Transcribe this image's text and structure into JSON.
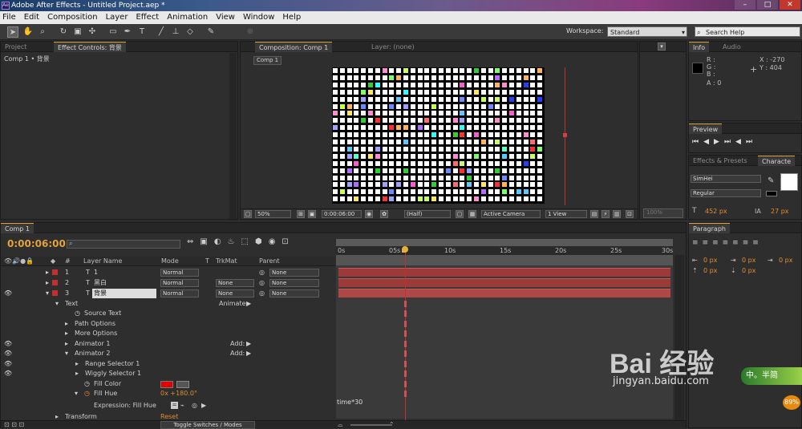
{
  "window": {
    "title": "Adobe After Effects - Untitled Project.aep *",
    "app_icon": "Ae"
  },
  "menu": [
    "File",
    "Edit",
    "Composition",
    "Layer",
    "Effect",
    "Animation",
    "View",
    "Window",
    "Help"
  ],
  "toolbar": {
    "workspace_label": "Workspace:",
    "workspace_value": "Standard",
    "search_placeholder": "Search Help"
  },
  "project_panel": {
    "tabs": [
      "Project",
      "Effect Controls: 背景"
    ],
    "breadcrumb": "Comp 1 • 背景"
  },
  "comp_panel": {
    "tabs": [
      "Composition: Comp 1",
      "Layer: (none)"
    ],
    "comp_tab": "Comp 1",
    "footer": {
      "zoom": "50%",
      "timecode": "0:00:06:00",
      "resolution": "(Half)",
      "camera": "Active Camera",
      "view": "1 View",
      "zoom_right": "100%"
    },
    "grid_colors": [
      "#ff5bd0",
      "#5bc8ff",
      "#ffe85b",
      "#7bff6b",
      "#ff6b6b",
      "#b56bff",
      "#5bffc9",
      "#ffb35b",
      "#6b8bff",
      "#ff8bd0",
      "#c9ff5b",
      "#a0a0ff",
      "#ff3030",
      "#30ffff",
      "#2040ff",
      "#30d030"
    ]
  },
  "info_panel": {
    "tabs": [
      "Info",
      "Audio"
    ],
    "R": "R :",
    "G": "G :",
    "B": "B :",
    "A": "A : 0",
    "X": "X : -270",
    "Y": "Y : 404"
  },
  "preview_panel": {
    "tab": "Preview"
  },
  "effects_panel": {
    "tabs": [
      "Effects & Presets",
      "Characte"
    ],
    "font": "SimHei",
    "style": "Regular",
    "size": "452 px",
    "tracking": "27 px"
  },
  "paragraph_panel": {
    "tab": "Paragraph",
    "values": [
      "0 px",
      "0 px",
      "0 px",
      "0 px",
      "0 px"
    ]
  },
  "timeline": {
    "tab": "Comp 1",
    "timecode": "0:00:06:00",
    "columns": {
      "number": "#",
      "layer_name": "Layer Name",
      "mode": "Mode",
      "t": "T",
      "trkmat": "TrkMat",
      "parent": "Parent"
    },
    "layers": [
      {
        "num": "1",
        "name": "1",
        "mode": "Normal",
        "trkmat": "",
        "parent": "None",
        "color": "#c03030"
      },
      {
        "num": "2",
        "name": "黑白",
        "mode": "Normal",
        "trkmat": "None",
        "parent": "None",
        "color": "#c03030"
      },
      {
        "num": "3",
        "name": "背景",
        "mode": "Normal",
        "trkmat": "None",
        "parent": "None",
        "color": "#c03030"
      }
    ],
    "props": {
      "text": "Text",
      "animate": "Animate:",
      "source_text": "Source Text",
      "path_options": "Path Options",
      "more_options": "More Options",
      "animator1": "Animator 1",
      "animator2": "Animator 2",
      "add": "Add:",
      "range_selector": "Range Selector 1",
      "wiggly_selector": "Wiggly Selector 1",
      "fill_color": "Fill Color",
      "fill_hue": "Fill Hue",
      "fill_hue_value": "0x +180.0°",
      "expression_label": "Expression: Fill Hue",
      "expression": "time*30",
      "transform": "Transform",
      "reset": "Reset"
    },
    "ruler": [
      "0s",
      "05s",
      "10s",
      "15s",
      "20s",
      "25s",
      "30s"
    ],
    "toggle_label": "Toggle Switches / Modes"
  },
  "watermark": {
    "text": "Bai 经验",
    "url": "jingyan.baidu.com",
    "badge": "89%"
  }
}
